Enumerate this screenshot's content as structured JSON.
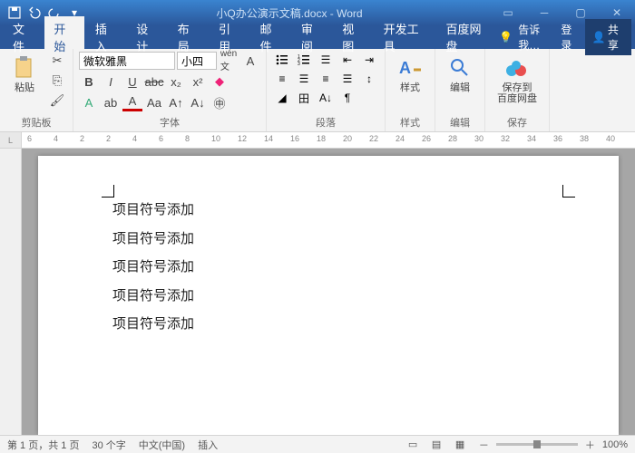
{
  "title": "小Q办公演示文稿.docx - Word",
  "tabs": {
    "file": "文件",
    "home": "开始",
    "insert": "插入",
    "design": "设计",
    "layout": "布局",
    "references": "引用",
    "mail": "邮件",
    "review": "审阅",
    "view": "视图",
    "dev": "开发工具",
    "baidu": "百度网盘"
  },
  "tell_me": "告诉我…",
  "login": "登录",
  "share": "共享",
  "groups": {
    "clipboard": "剪贴板",
    "font": "字体",
    "paragraph": "段落",
    "styles": "样式",
    "editing": "编辑",
    "save": "保存"
  },
  "paste": "粘贴",
  "styles_btn": "样式",
  "editing_btn": "编辑",
  "save_btn": "保存到\n百度网盘",
  "font_name": "微软雅黑",
  "font_size": "小四",
  "doc_lines": [
    "项目符号添加",
    "项目符号添加",
    "项目符号添加",
    "项目符号添加",
    "项目符号添加"
  ],
  "ruler_nums": [
    "6",
    "4",
    "2",
    "2",
    "4",
    "6",
    "8",
    "10",
    "12",
    "14",
    "16",
    "18",
    "20",
    "22",
    "24",
    "26",
    "28",
    "30",
    "32",
    "34",
    "36",
    "38",
    "40"
  ],
  "status": {
    "page": "第 1 页，共 1 页",
    "words": "30 个字",
    "lang": "中文(中国)",
    "mode": "插入",
    "zoom": "100%"
  }
}
